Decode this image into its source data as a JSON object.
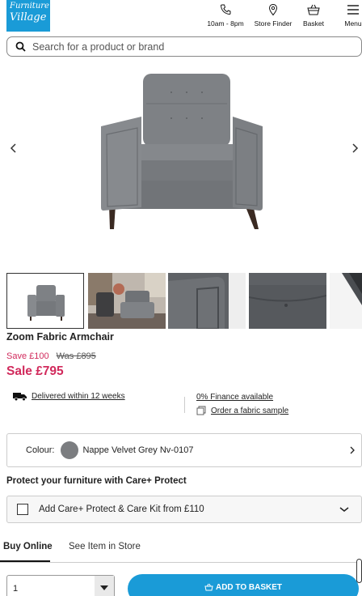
{
  "brand": {
    "logo_line1": "Furniture",
    "logo_line2": "Village"
  },
  "nav": {
    "hours": "10am - 8pm",
    "store_finder": "Store Finder",
    "basket": "Basket",
    "menu": "Menu"
  },
  "search": {
    "placeholder": "Search for a product or brand"
  },
  "product": {
    "title": "Zoom Fabric Armchair",
    "save": "Save £100",
    "was": "Was £895",
    "sale": "Sale £795"
  },
  "info": {
    "delivery": "Delivered within 12 weeks",
    "finance": "0% Finance available",
    "sample": "Order a fabric sample"
  },
  "colour": {
    "label": "Colour:",
    "value": "Nappe Velvet Grey Nv-0107",
    "swatch": "#7b7d80"
  },
  "protect": {
    "title": "Protect your furniture with Care+ Protect",
    "option": "Add Care+ Protect & Care Kit from £110"
  },
  "tabs": [
    {
      "label": "Buy Online"
    },
    {
      "label": "See Item in Store"
    }
  ],
  "purchase": {
    "quantity": "1",
    "add_button": "ADD TO BASKET"
  },
  "icons": {
    "phone": "phone-icon",
    "location": "location-pin-icon",
    "basket": "basket-icon",
    "menu": "hamburger-icon",
    "search": "search-icon",
    "prev": "chevron-left-icon",
    "next": "chevron-right-icon",
    "truck": "truck-icon",
    "sample": "fabric-sample-icon",
    "chevron_right": "chevron-right-icon",
    "chevron_down": "chevron-down-icon",
    "dropdown": "triangle-down-icon"
  },
  "colors": {
    "brand_blue": "#1a9bd7",
    "sale_pink": "#d12a5c"
  }
}
